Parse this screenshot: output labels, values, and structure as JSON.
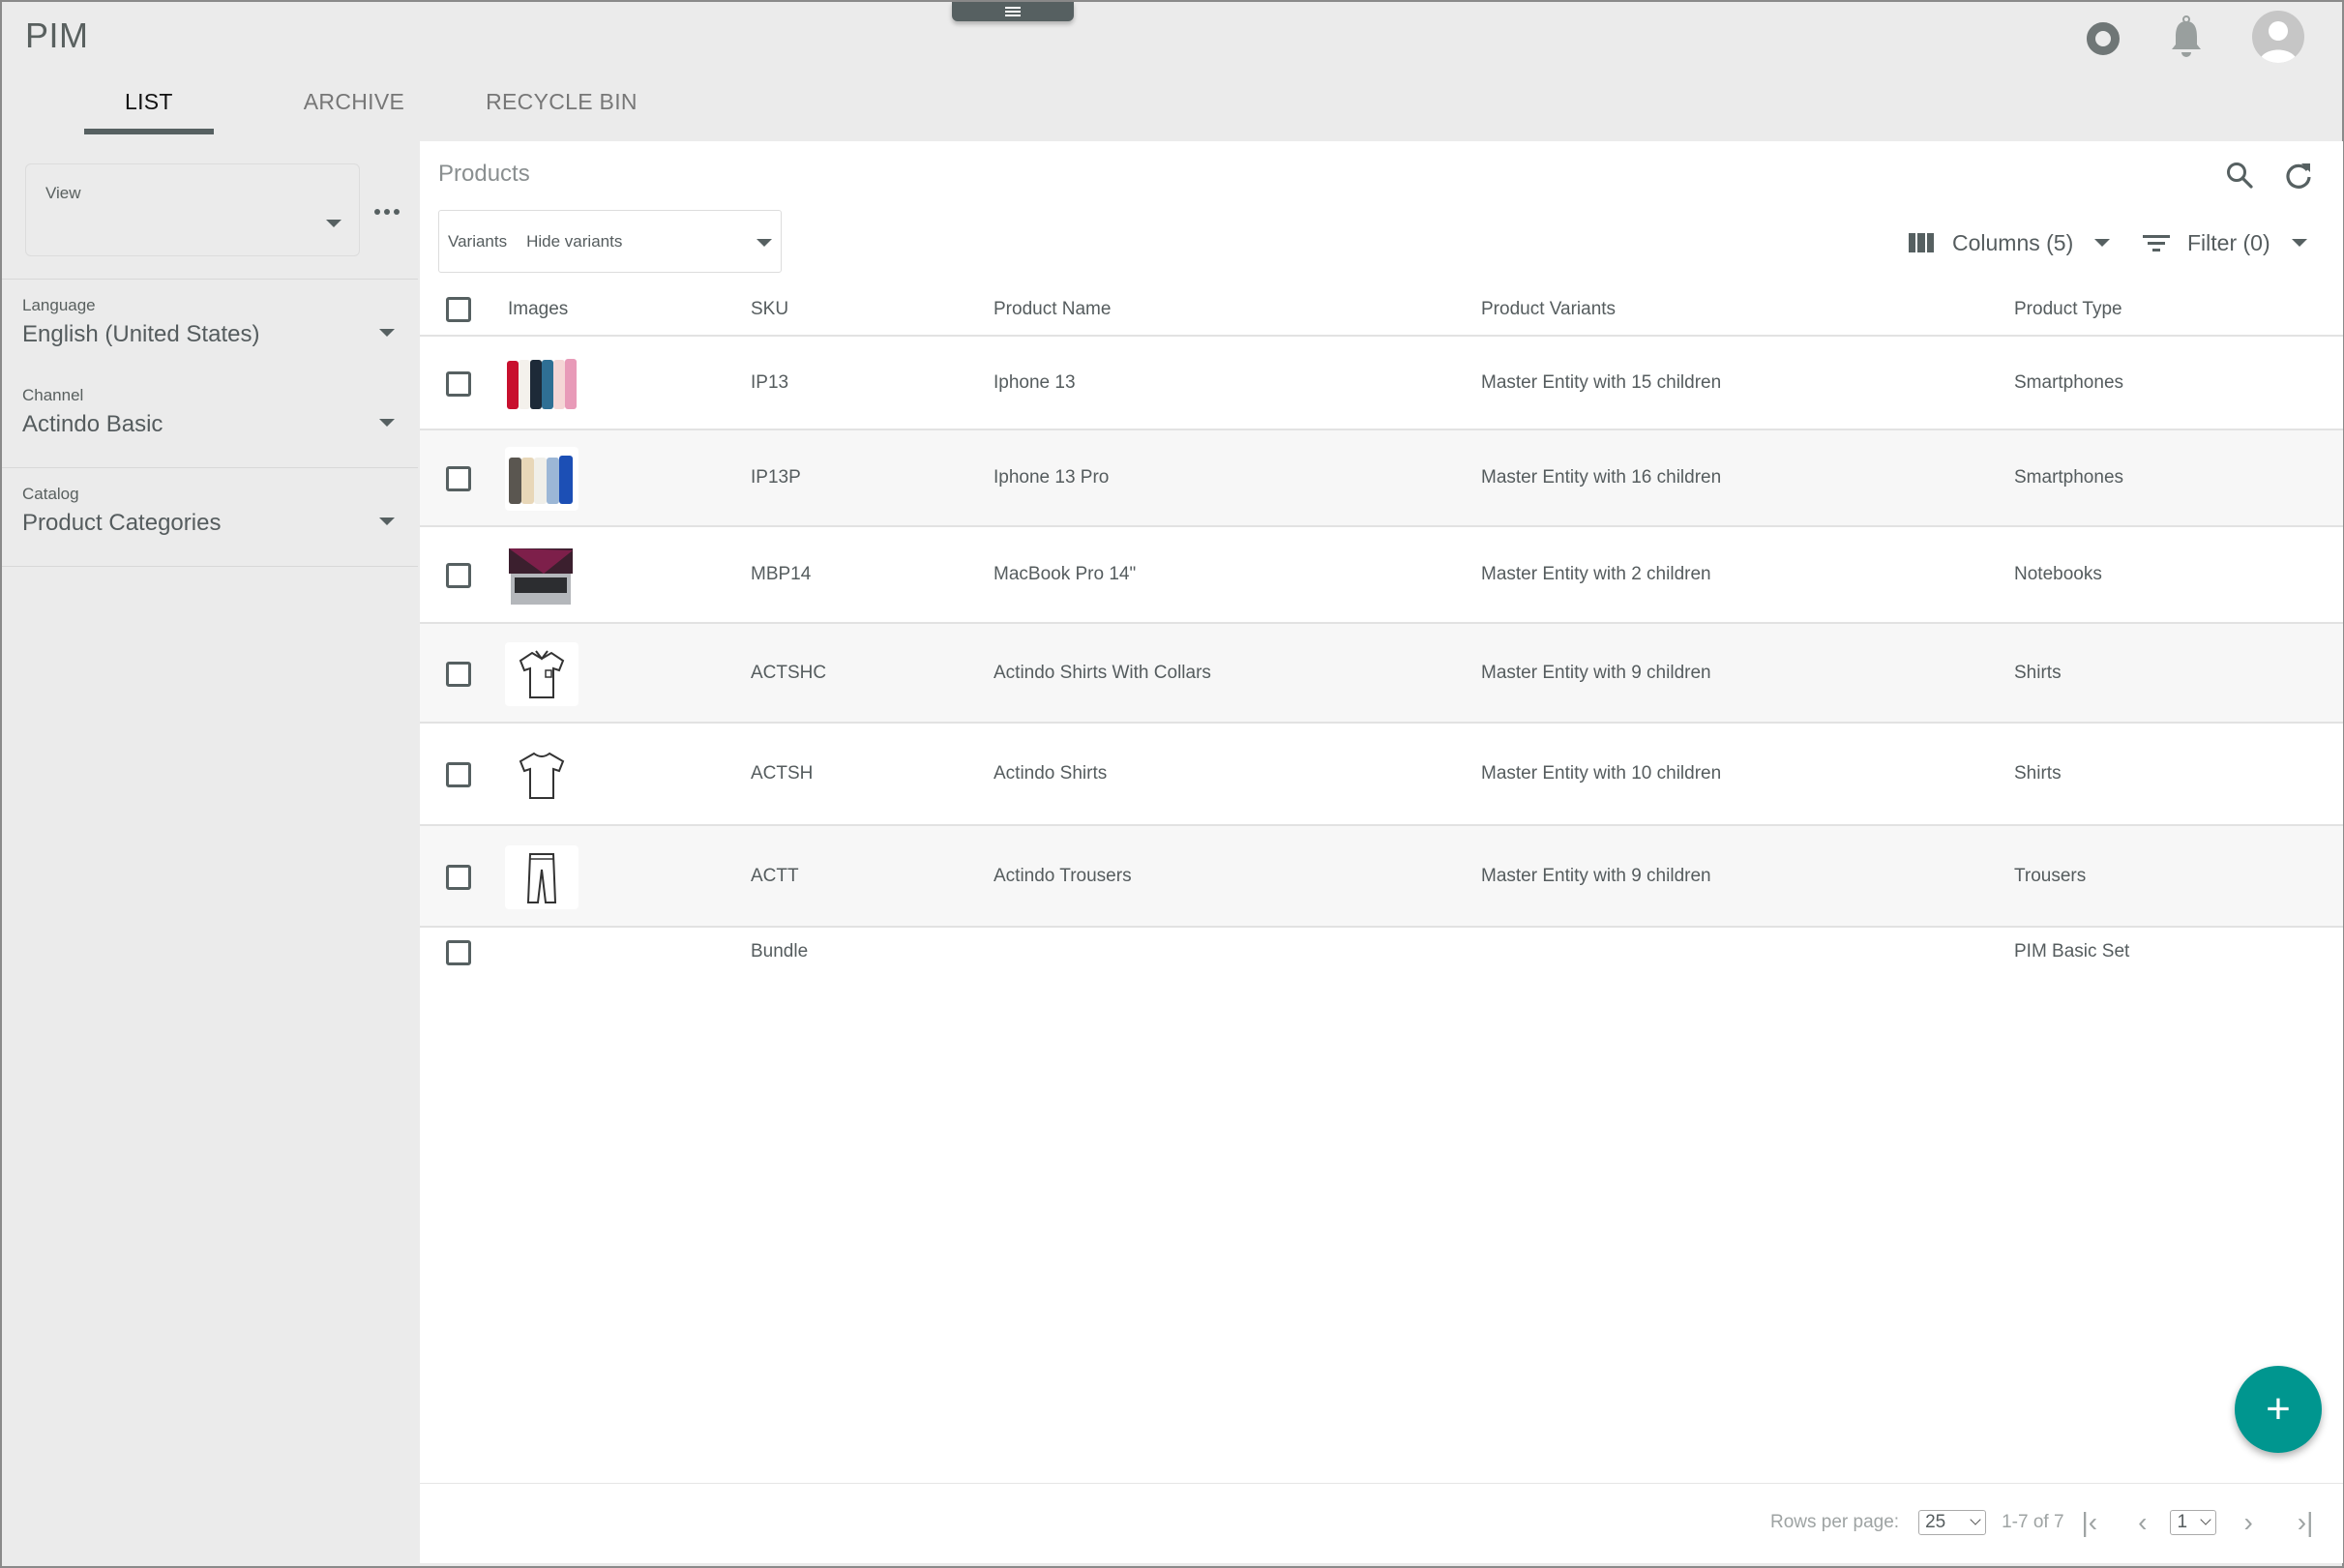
{
  "app": {
    "title": "PIM"
  },
  "header_icons": {
    "menu": "hamburger-icon",
    "status": "ring-icon",
    "notifications": "bell-icon",
    "user": "avatar-icon"
  },
  "tabs": [
    {
      "label": "LIST",
      "active": true
    },
    {
      "label": "ARCHIVE",
      "active": false
    },
    {
      "label": "RECYCLE BIN",
      "active": false
    }
  ],
  "sidebar": {
    "view": {
      "label": "View",
      "value": ""
    },
    "language": {
      "label": "Language",
      "value": "English (United States)"
    },
    "channel": {
      "label": "Channel",
      "value": "Actindo Basic"
    },
    "catalog": {
      "label": "Catalog",
      "value": "Product Categories"
    }
  },
  "main": {
    "title": "Products",
    "variants": {
      "label": "Variants",
      "value": "Hide variants"
    },
    "columns_label": "Columns (5)",
    "filter_label": "Filter (0)",
    "columns": [
      "Images",
      "SKU",
      "Product Name",
      "Product Variants",
      "Product Type"
    ],
    "rows": [
      {
        "image": "iphone-13-image",
        "sku": "IP13",
        "name": "Iphone 13",
        "variants": "Master Entity with 15 children",
        "type": "Smartphones"
      },
      {
        "image": "iphone-13-pro-image",
        "sku": "IP13P",
        "name": "Iphone 13 Pro",
        "variants": "Master Entity with 16 children",
        "type": "Smartphones"
      },
      {
        "image": "macbook-pro-image",
        "sku": "MBP14",
        "name": "MacBook Pro 14\"",
        "variants": "Master Entity with 2 children",
        "type": "Notebooks"
      },
      {
        "image": "collar-shirt-image",
        "sku": "ACTSHC",
        "name": "Actindo Shirts With Collars",
        "variants": "Master Entity with 9 children",
        "type": "Shirts"
      },
      {
        "image": "tshirt-image",
        "sku": "ACTSH",
        "name": "Actindo Shirts",
        "variants": "Master Entity with 10 children",
        "type": "Shirts"
      },
      {
        "image": "trousers-image",
        "sku": "ACTT",
        "name": "Actindo Trousers",
        "variants": "Master Entity with 9 children",
        "type": "Trousers"
      },
      {
        "image": "",
        "sku": "Bundle",
        "name": "",
        "variants": "",
        "type": "PIM Basic Set"
      }
    ],
    "pagination": {
      "rows_per_page_label": "Rows per page:",
      "rows_per_page": "25",
      "range": "1-7 of 7",
      "page": "1"
    },
    "fab_label": "+"
  },
  "colors": {
    "accent": "#00968f",
    "header_bg": "#ebebeb",
    "tab_indicator": "#566061"
  }
}
